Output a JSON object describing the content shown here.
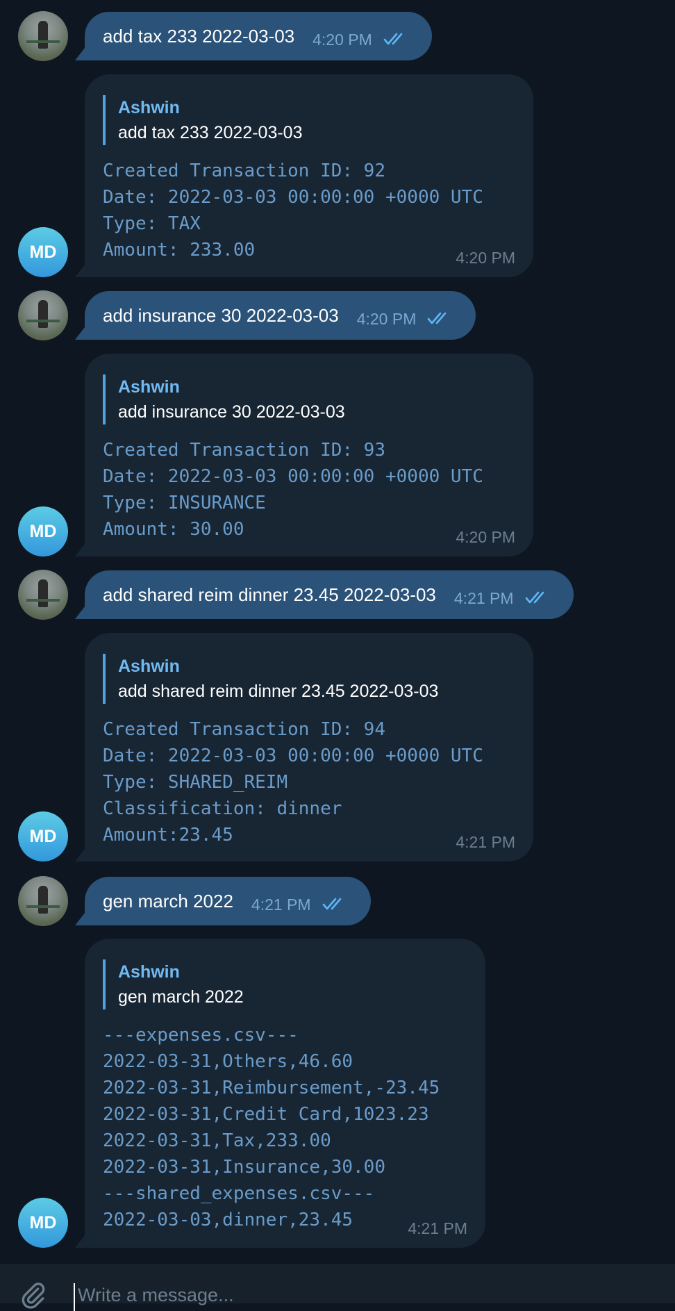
{
  "messages": [
    {
      "out": {
        "text": "add tax 233 2022-03-03",
        "time": "4:20 PM"
      },
      "reply": {
        "quote_name": "Ashwin",
        "quote_text": "add tax 233 2022-03-03",
        "lines": [
          "Created Transaction ID: 92",
          "Date: 2022-03-03 00:00:00 +0000 UTC",
          "Type: TAX",
          "Amount: 233.00"
        ],
        "time": "4:20 PM",
        "avatar": "MD"
      }
    },
    {
      "out": {
        "text": "add insurance 30 2022-03-03",
        "time": "4:20 PM"
      },
      "reply": {
        "quote_name": "Ashwin",
        "quote_text": "add insurance 30 2022-03-03",
        "lines": [
          "Created Transaction ID: 93",
          "Date: 2022-03-03 00:00:00 +0000 UTC",
          "Type: INSURANCE",
          "Amount: 30.00"
        ],
        "time": "4:20 PM",
        "avatar": "MD"
      }
    },
    {
      "out": {
        "text": "add shared reim dinner 23.45 2022-03-03",
        "time": "4:21 PM"
      },
      "reply": {
        "quote_name": "Ashwin",
        "quote_text": "add shared reim dinner 23.45 2022-03-03",
        "lines": [
          "Created Transaction ID: 94",
          "Date: 2022-03-03 00:00:00 +0000 UTC",
          "Type: SHARED_REIM",
          "Classification: dinner",
          "Amount:23.45"
        ],
        "time": "4:21 PM",
        "avatar": "MD"
      }
    },
    {
      "out": {
        "text": "gen march 2022",
        "time": "4:21 PM"
      },
      "reply": {
        "quote_name": "Ashwin",
        "quote_text": "gen march 2022",
        "lines": [
          "---expenses.csv---",
          "2022-03-31,Others,46.60",
          "2022-03-31,Reimbursement,-23.45",
          "2022-03-31,Credit Card,1023.23",
          "2022-03-31,Tax,233.00",
          "2022-03-31,Insurance,30.00",
          "---shared_expenses.csv---",
          "2022-03-03,dinner,23.45"
        ],
        "time": "4:21 PM",
        "avatar": "MD"
      }
    }
  ],
  "composer": {
    "placeholder": "Write a message..."
  },
  "colors": {
    "background": "#0e1621",
    "outgoing": "#2b5278",
    "incoming": "#182533",
    "accent": "#71baf1"
  }
}
